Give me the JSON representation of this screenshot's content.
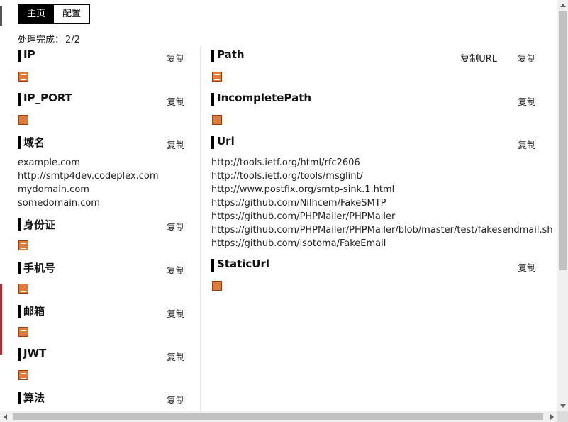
{
  "tabs": [
    {
      "label": "主页",
      "active": true
    },
    {
      "label": "配置",
      "active": false
    }
  ],
  "status": {
    "label": "处理完成：",
    "count": "2/2"
  },
  "copy_label": "复制",
  "copy_url_label": "复制URL",
  "left_sections": [
    {
      "title": "IP",
      "empty": true,
      "items": []
    },
    {
      "title": "IP_PORT",
      "empty": true,
      "items": []
    },
    {
      "title": "域名",
      "empty": false,
      "items": [
        "example.com",
        "http://smtp4dev.codeplex.com",
        "mydomain.com",
        "somedomain.com"
      ]
    },
    {
      "title": "身份证",
      "empty": true,
      "items": []
    },
    {
      "title": "手机号",
      "empty": true,
      "items": []
    },
    {
      "title": "邮箱",
      "empty": true,
      "items": []
    },
    {
      "title": "JWT",
      "empty": true,
      "items": []
    },
    {
      "title": "算法",
      "empty": false,
      "items": []
    }
  ],
  "right_sections": [
    {
      "title": "Path",
      "empty": true,
      "has_copy_url": true,
      "items": []
    },
    {
      "title": "IncompletePath",
      "empty": true,
      "has_copy_url": false,
      "items": []
    },
    {
      "title": "Url",
      "empty": false,
      "has_copy_url": false,
      "items": [
        "http://tools.ietf.org/html/rfc2606",
        "http://tools.ietf.org/tools/msglint/",
        "http://www.postfix.org/smtp-sink.1.html",
        "https://github.com/Nilhcem/FakeSMTP",
        "https://github.com/PHPMailer/PHPMailer",
        "https://github.com/PHPMailer/PHPMailer/blob/master/test/fakesendmail.sh",
        "https://github.com/isotoma/FakeEmail"
      ]
    },
    {
      "title": "StaticUrl",
      "empty": true,
      "has_copy_url": false,
      "items": []
    }
  ],
  "empty_icon": "none-icon"
}
